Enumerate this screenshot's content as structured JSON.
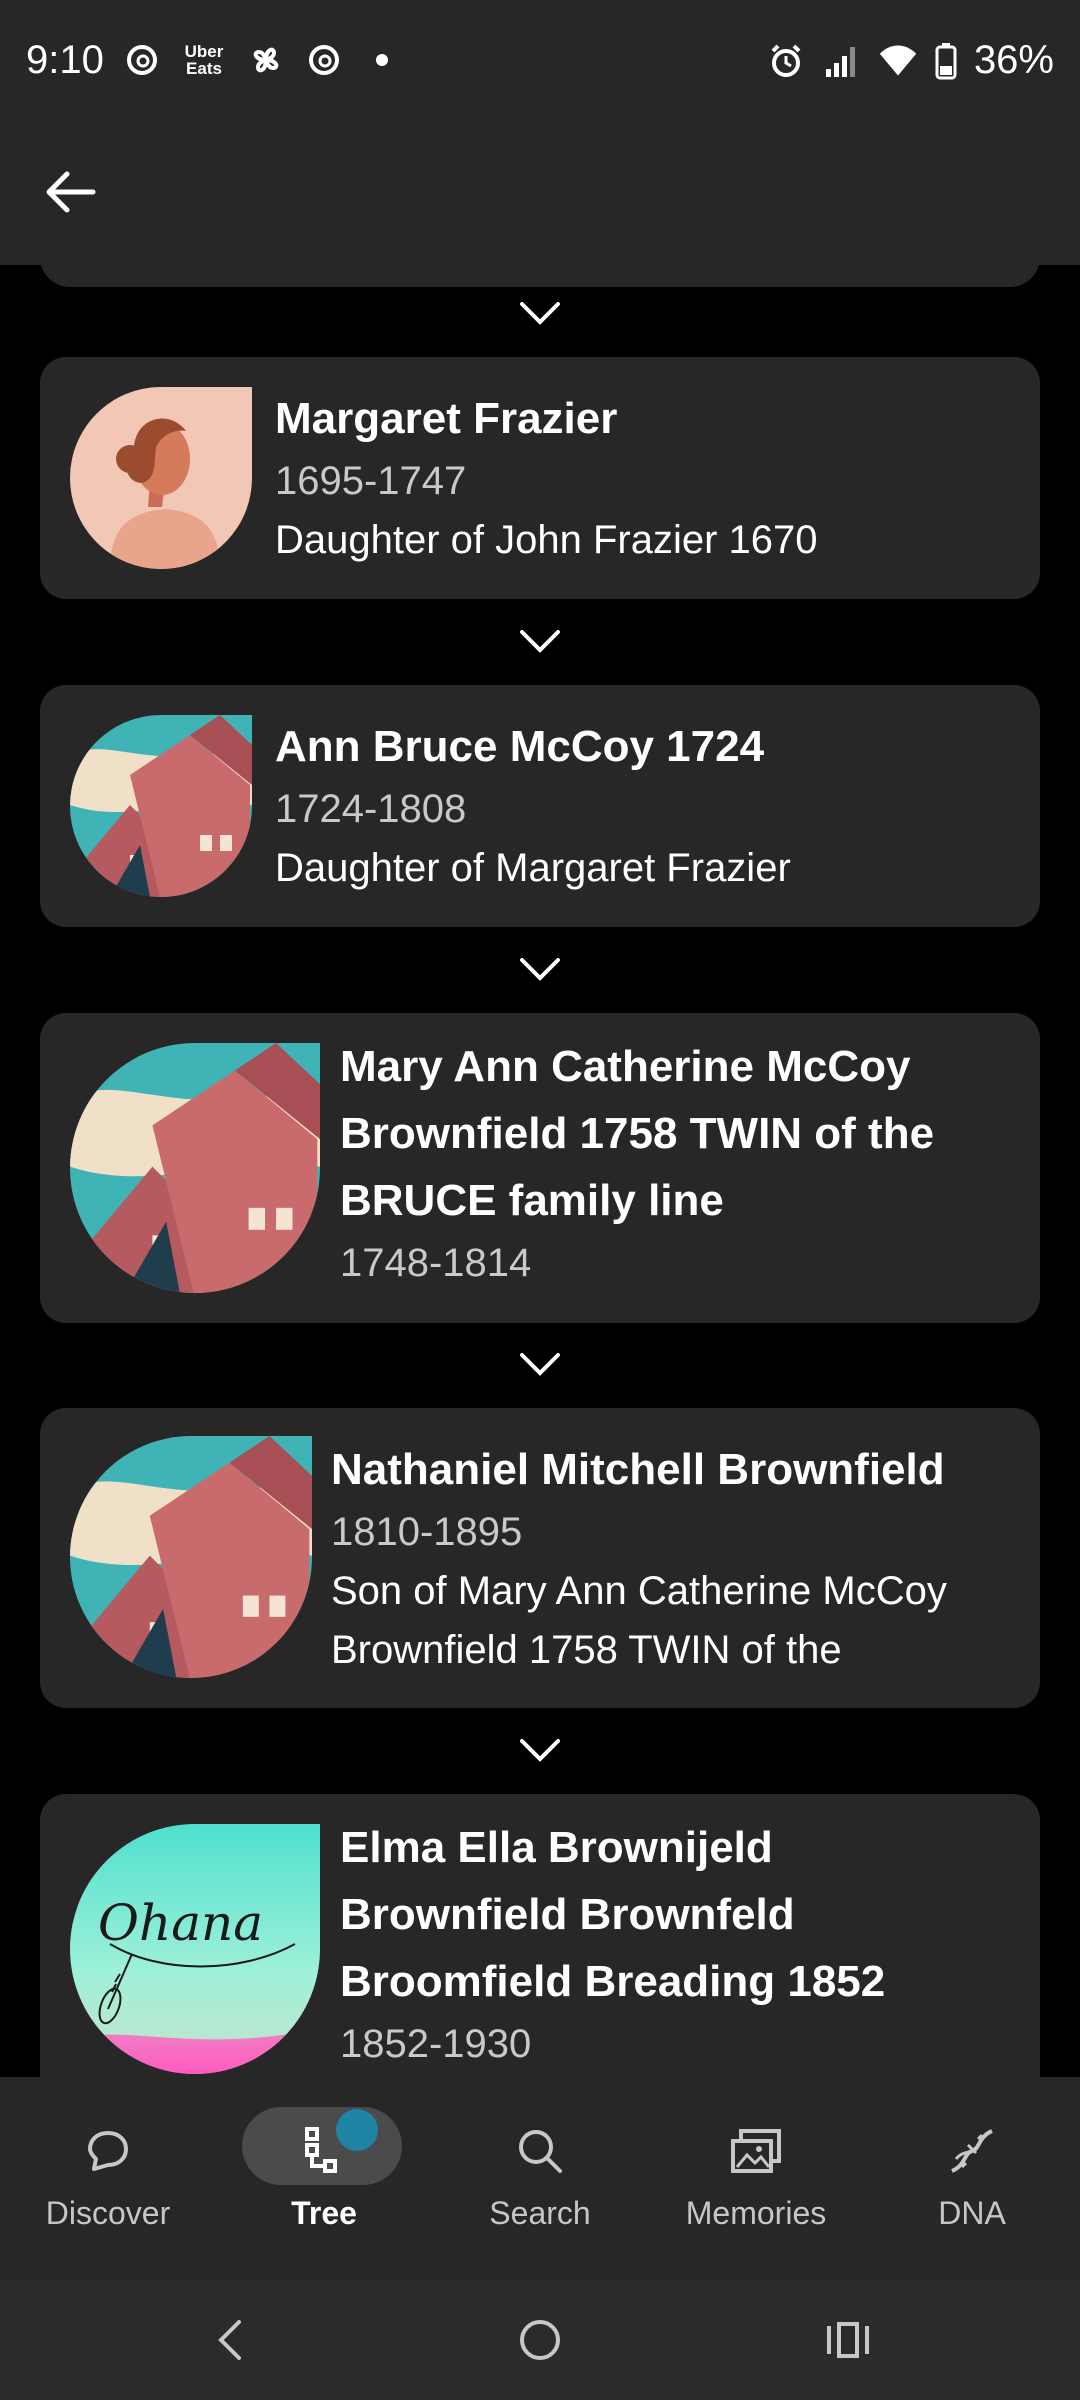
{
  "status_bar": {
    "time": "9:10",
    "left_icons": [
      "threads-icon",
      "uber-eats-icon",
      "pinwheel-icon",
      "threads-icon",
      "dot-icon"
    ],
    "uber_text": "Uber\nEats",
    "battery": "36%"
  },
  "header": {
    "back_icon": "arrow-left-icon"
  },
  "people": [
    {
      "name": "Margaret Frazier",
      "dates": "1695-1747",
      "relation": "Daughter of John Frazier 1670",
      "avatar": "woman-silhouette"
    },
    {
      "name": "Ann Bruce McCoy 1724",
      "dates": "1724-1808",
      "relation": "Daughter of Margaret Frazier",
      "avatar": "house-photo"
    },
    {
      "name": "Mary Ann Catherine McCoy Brownfield 1758 TWIN of the BRUCE family line",
      "dates": "1748-1814",
      "relation": "",
      "avatar": "house-photo"
    },
    {
      "name": "Nathaniel Mitchell Brownfield",
      "dates": "1810-1895",
      "relation": "Son of Mary Ann Catherine McCoy Brownfield 1758 TWIN of the",
      "avatar": "house-photo"
    },
    {
      "name": "Elma Ella Brownijeld Brownfield Brownfeld Broomfield Breading 1852",
      "dates": "1852-1930",
      "relation": "",
      "avatar": "ohana-art"
    }
  ],
  "ohana_text": "Ohana",
  "nav": {
    "items": [
      {
        "label": "Discover",
        "icon": "discover-icon"
      },
      {
        "label": "Tree",
        "icon": "tree-icon",
        "active": true
      },
      {
        "label": "Search",
        "icon": "search-icon"
      },
      {
        "label": "Memories",
        "icon": "memories-icon"
      },
      {
        "label": "DNA",
        "icon": "dna-icon"
      }
    ]
  },
  "colors": {
    "background": "#000000",
    "card": "#272727",
    "accent": "#1f83a3",
    "muted_text": "#c9c9c9"
  }
}
